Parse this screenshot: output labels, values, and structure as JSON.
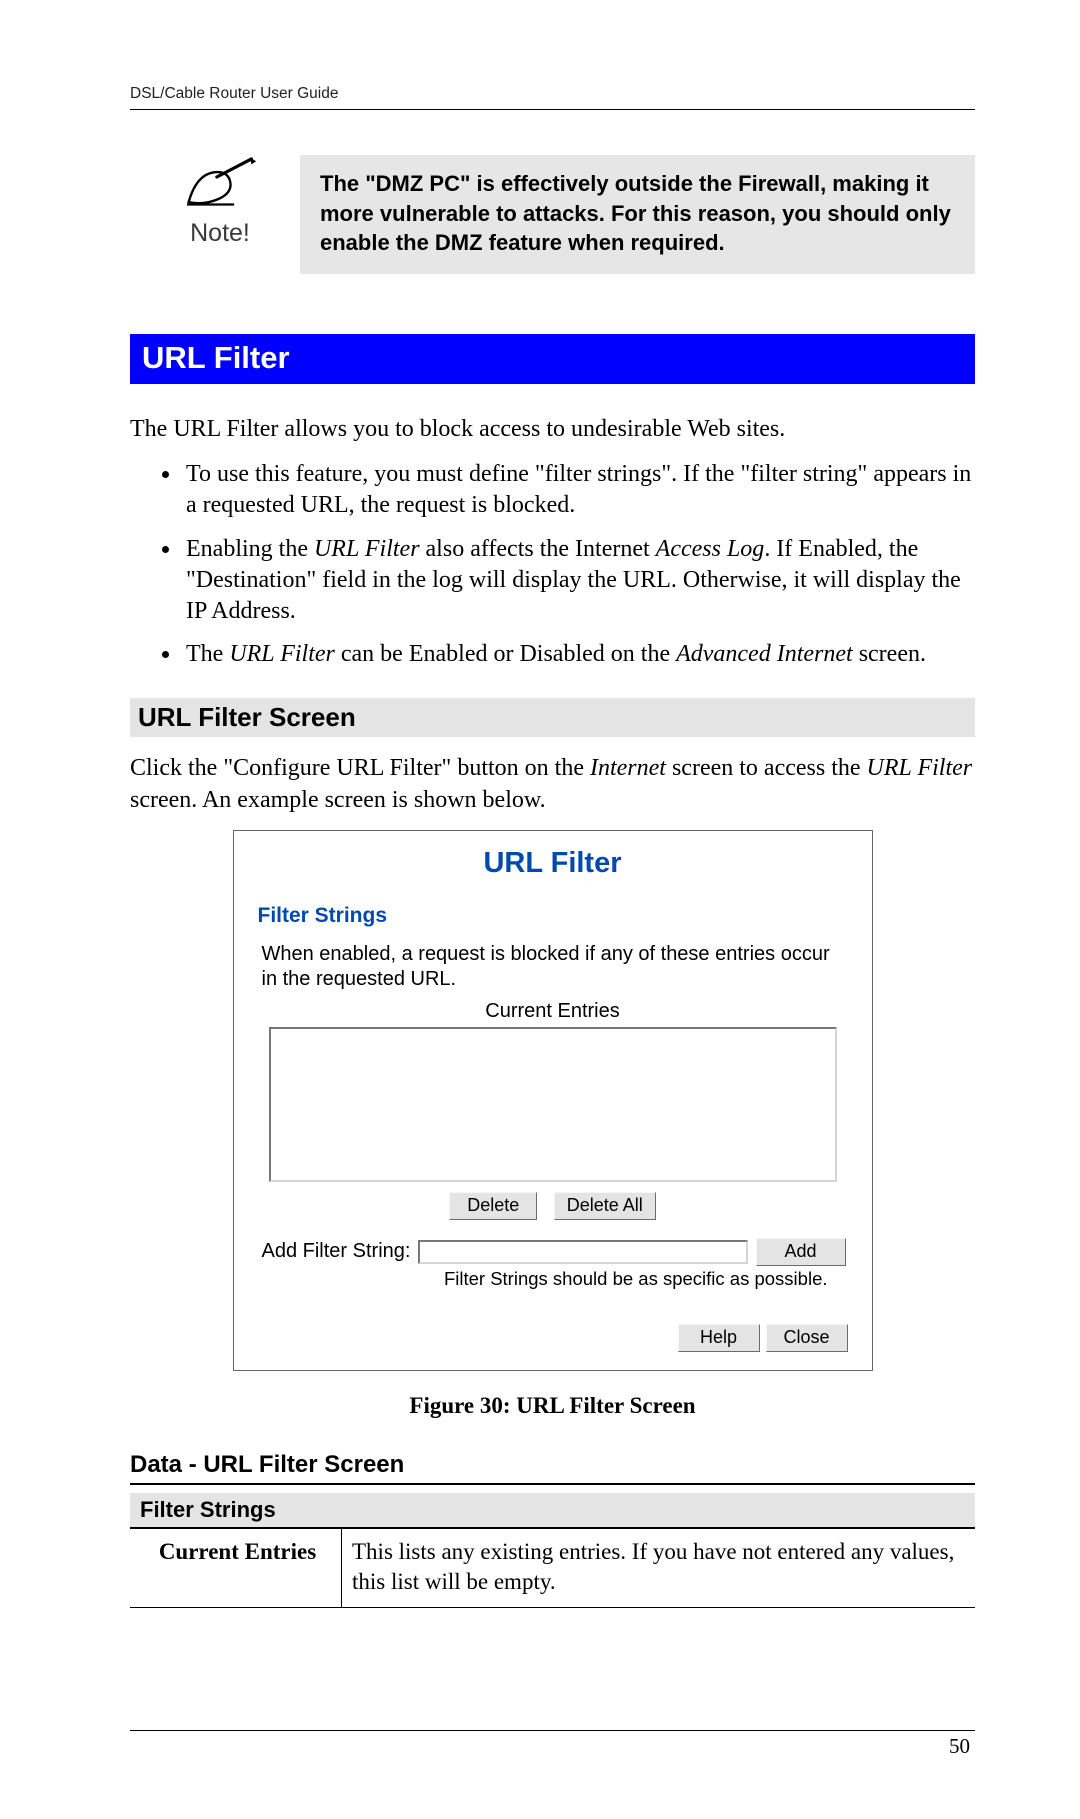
{
  "running_head": "DSL/Cable Router User Guide",
  "note": {
    "label": "Note!",
    "text": "The \"DMZ PC\" is effectively outside the Firewall, making it more vulnerable to attacks. For this reason, you should only enable the DMZ feature when required."
  },
  "section_title": "URL Filter",
  "intro": "The URL Filter allows you to block access to undesirable Web sites.",
  "bullets": [
    {
      "plain": "To use this feature, you must define \"filter strings\". If the \"filter string\" appears in a requested URL, the request is blocked."
    },
    {
      "prefix": "Enabling the ",
      "i1": "URL Filter",
      "mid": " also affects the Internet ",
      "i2": "Access Log",
      "suffix": ". If Enabled, the \"Destination\" field in the log will display the URL. Otherwise, it will display the IP Address."
    },
    {
      "prefix": "The ",
      "i1": "URL Filter",
      "mid": " can be Enabled or Disabled on the ",
      "i2": "Advanced Internet",
      "suffix": " screen."
    }
  ],
  "sub_heading": "URL Filter Screen",
  "sub_para": {
    "p1": "Click the \"Configure URL Filter\" button on the ",
    "i1": "Internet",
    "p2": " screen to access the ",
    "i2": "URL Filter",
    "p3": " screen. An example screen is shown below."
  },
  "shot": {
    "title": "URL Filter",
    "subtitle": "Filter Strings",
    "desc": "When enabled, a request is blocked if any of these entries occur in the requested URL.",
    "current_entries_label": "Current Entries",
    "delete_label": "Delete",
    "delete_all_label": "Delete All",
    "add_filter_label": "Add Filter String:",
    "add_label": "Add",
    "hint": "Filter Strings should be as specific as possible.",
    "help_label": "Help",
    "close_label": "Close"
  },
  "figure_caption": "Figure 30: URL Filter Screen",
  "data_heading": "Data - URL Filter Screen",
  "table": {
    "group_head": "Filter Strings",
    "row1_key": "Current Entries",
    "row1_val": "This lists any existing entries. If you have not entered any values, this list will be empty."
  },
  "page_number": "50"
}
